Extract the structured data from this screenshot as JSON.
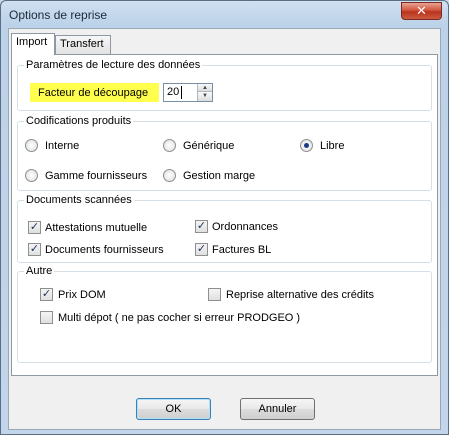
{
  "window": {
    "title": "Options de reprise",
    "close_glyph": "✕"
  },
  "tabs": [
    {
      "label": "Import",
      "active": true
    },
    {
      "label": "Transfert",
      "active": false
    }
  ],
  "groups": {
    "lecture": {
      "legend": "Paramètres de lecture des données",
      "facteur_label": "Facteur de découpage",
      "facteur_value": "20"
    },
    "codifications": {
      "legend": "Codifications produits",
      "options": [
        {
          "label": "Interne",
          "checked": false
        },
        {
          "label": "Générique",
          "checked": false
        },
        {
          "label": "Libre",
          "checked": true
        },
        {
          "label": "Gamme fournisseurs",
          "checked": false
        },
        {
          "label": "Gestion marge",
          "checked": false
        }
      ]
    },
    "documents": {
      "legend": "Documents scannées",
      "items": [
        {
          "label": "Attestations mutuelle",
          "checked": true
        },
        {
          "label": "Ordonnances",
          "checked": true
        },
        {
          "label": "Documents fournisseurs",
          "checked": true
        },
        {
          "label": "Factures BL",
          "checked": true
        }
      ]
    },
    "autre": {
      "legend": "Autre",
      "items": [
        {
          "label": "Prix DOM",
          "checked": true
        },
        {
          "label": "Reprise alternative des crédits",
          "checked": false
        },
        {
          "label": "Multi dépot ( ne pas cocher si erreur PRODGEO )",
          "checked": false
        }
      ]
    }
  },
  "buttons": {
    "ok": "OK",
    "cancel": "Annuler"
  },
  "check_glyph": "✓",
  "spin_up_glyph": "▲",
  "spin_down_glyph": "▼"
}
